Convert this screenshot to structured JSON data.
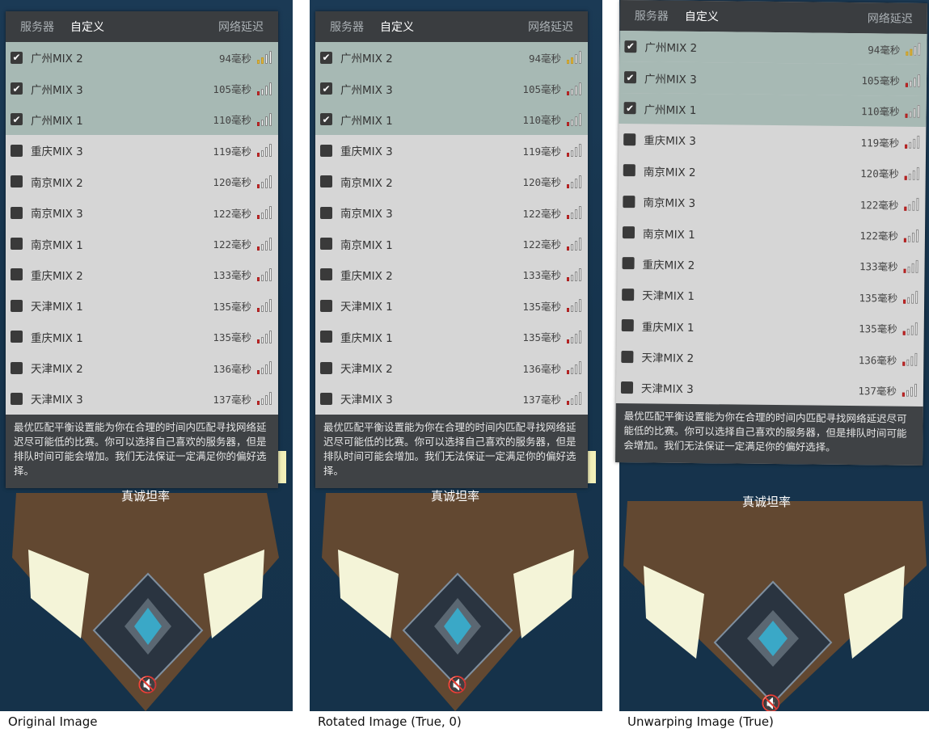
{
  "tabs": {
    "server": "服务器",
    "custom": "自定义",
    "latency": "网络延迟"
  },
  "servers": [
    {
      "name": "广州MIX 2",
      "ms": "94毫秒",
      "checked": true,
      "signal": "yellow"
    },
    {
      "name": "广州MIX 3",
      "ms": "105毫秒",
      "checked": true,
      "signal": "red"
    },
    {
      "name": "广州MIX 1",
      "ms": "110毫秒",
      "checked": true,
      "signal": "red"
    },
    {
      "name": "重庆MIX 3",
      "ms": "119毫秒",
      "checked": false,
      "signal": "red"
    },
    {
      "name": "南京MIX 2",
      "ms": "120毫秒",
      "checked": false,
      "signal": "red"
    },
    {
      "name": "南京MIX 3",
      "ms": "122毫秒",
      "checked": false,
      "signal": "red"
    },
    {
      "name": "南京MIX 1",
      "ms": "122毫秒",
      "checked": false,
      "signal": "red"
    },
    {
      "name": "重庆MIX 2",
      "ms": "133毫秒",
      "checked": false,
      "signal": "red"
    },
    {
      "name": "天津MIX 1",
      "ms": "135毫秒",
      "checked": false,
      "signal": "red"
    },
    {
      "name": "重庆MIX 1",
      "ms": "135毫秒",
      "checked": false,
      "signal": "red"
    },
    {
      "name": "天津MIX 2",
      "ms": "136毫秒",
      "checked": false,
      "signal": "red"
    },
    {
      "name": "天津MIX 3",
      "ms": "137毫秒",
      "checked": false,
      "signal": "red"
    }
  ],
  "footer": "最优匹配平衡设置能为你在合理的时间内匹配寻找网络延迟尽可能低的比赛。你可以选择自己喜欢的服务器，但是排队时间可能会增加。我们无法保证一定满足你的偏好选择。",
  "behind_text": "真诚坦率",
  "mute_icon": "🔇",
  "captions": [
    "Original Image",
    "Rotated Image (True, 0)",
    "Unwarping Image (True)"
  ]
}
